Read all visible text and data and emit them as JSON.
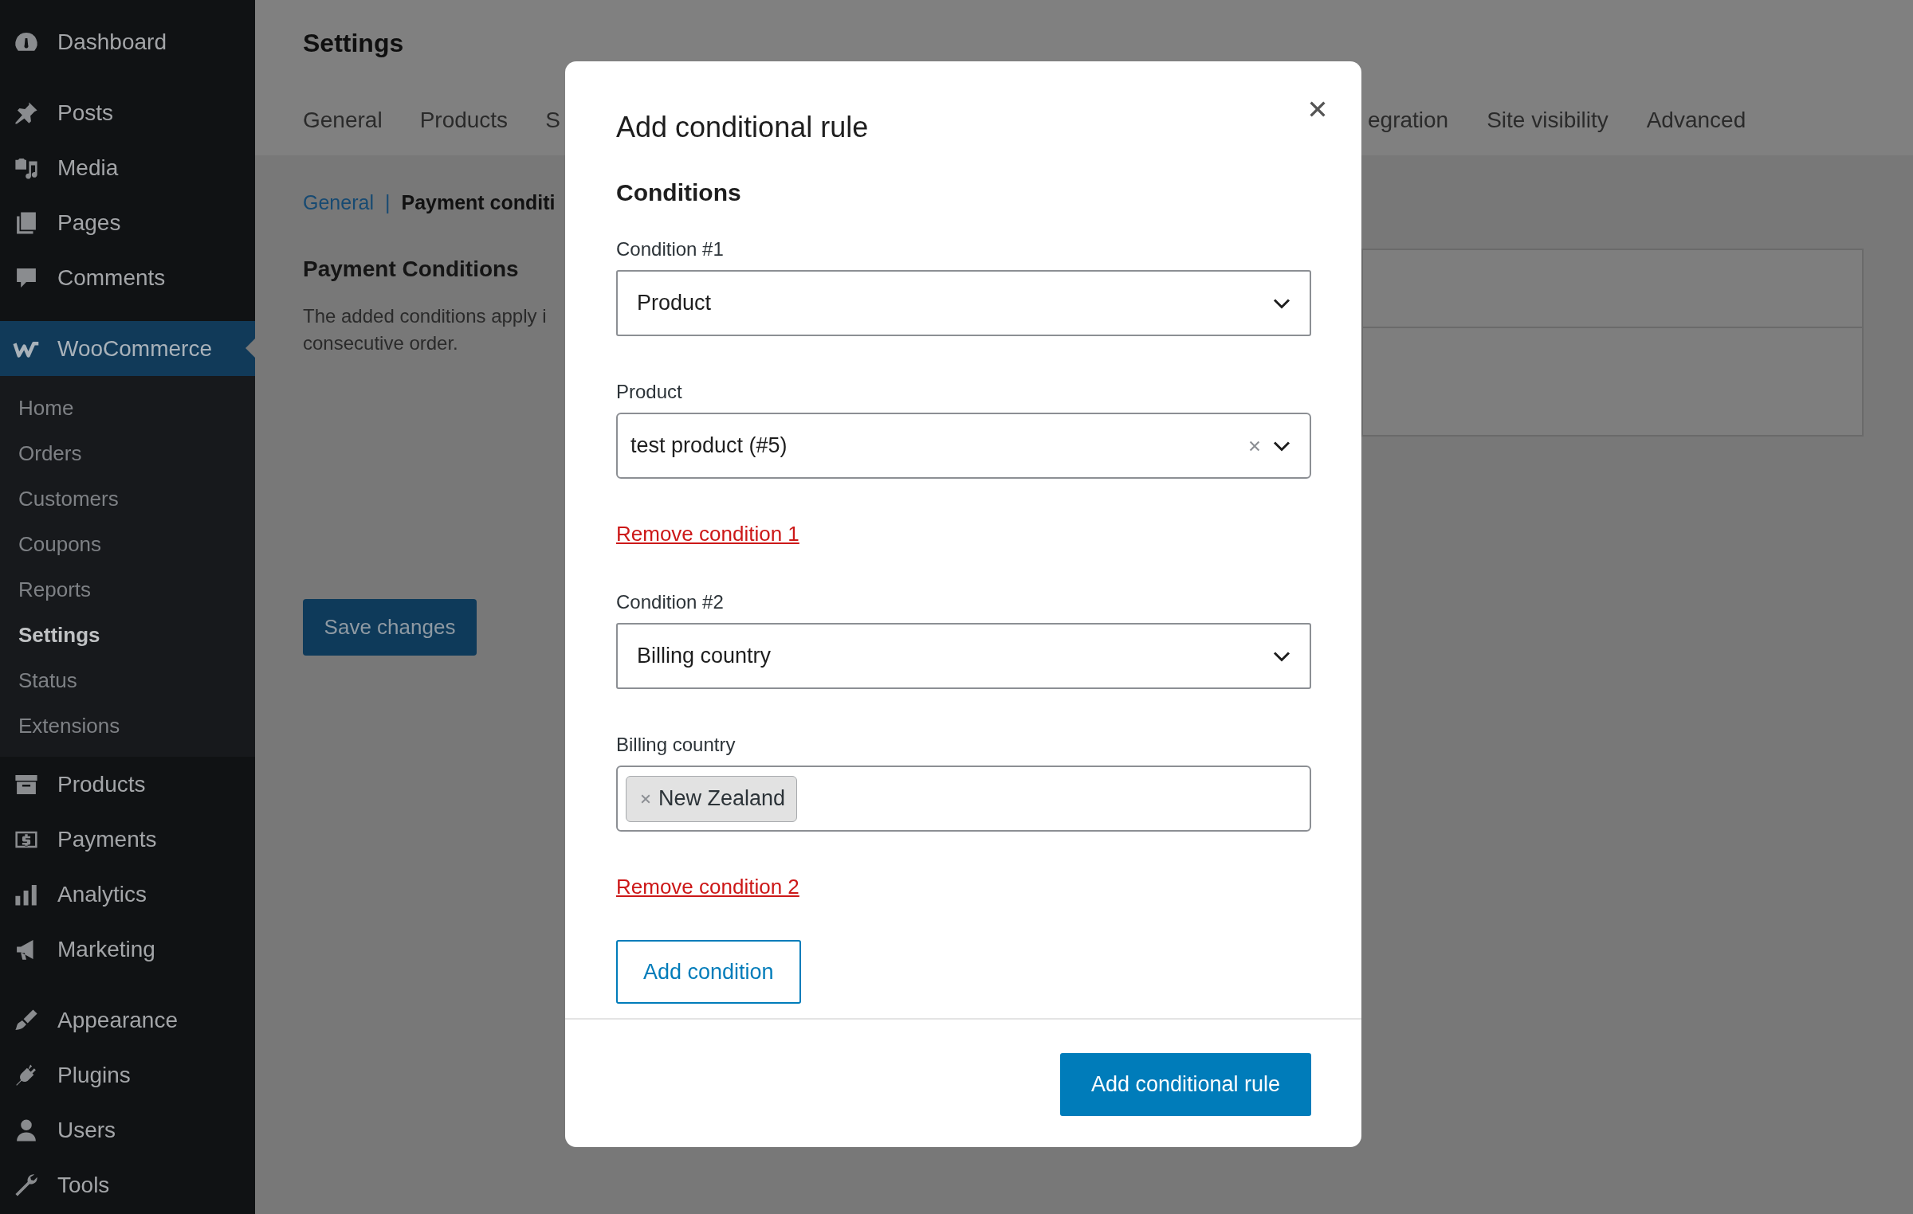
{
  "sidebar": {
    "groups": [
      {
        "items": [
          {
            "label": "Dashboard",
            "selected": false
          }
        ]
      },
      {
        "items": [
          {
            "label": "Posts",
            "selected": false
          },
          {
            "label": "Media",
            "selected": false
          },
          {
            "label": "Pages",
            "selected": false
          },
          {
            "label": "Comments",
            "selected": false
          }
        ]
      },
      {
        "items": [
          {
            "label": "WooCommerce",
            "selected": true,
            "children": [
              {
                "label": "Home",
                "selected": false
              },
              {
                "label": "Orders",
                "selected": false
              },
              {
                "label": "Customers",
                "selected": false
              },
              {
                "label": "Coupons",
                "selected": false
              },
              {
                "label": "Reports",
                "selected": false
              },
              {
                "label": "Settings",
                "selected": true
              },
              {
                "label": "Status",
                "selected": false
              },
              {
                "label": "Extensions",
                "selected": false
              }
            ]
          },
          {
            "label": "Products",
            "selected": false
          },
          {
            "label": "Payments",
            "selected": false
          },
          {
            "label": "Analytics",
            "selected": false
          },
          {
            "label": "Marketing",
            "selected": false
          }
        ]
      },
      {
        "items": [
          {
            "label": "Appearance",
            "selected": false
          },
          {
            "label": "Plugins",
            "selected": false
          },
          {
            "label": "Users",
            "selected": false
          },
          {
            "label": "Tools",
            "selected": false
          }
        ]
      }
    ]
  },
  "page": {
    "title": "Settings",
    "tabs": [
      {
        "label": "General"
      },
      {
        "label": "Products"
      },
      {
        "label": "S"
      },
      {
        "label": "egration"
      },
      {
        "label": "Site visibility"
      },
      {
        "label": "Advanced"
      }
    ],
    "breadcrumb": [
      {
        "label": "General",
        "kind": "link"
      },
      {
        "label": "|",
        "kind": "separator"
      },
      {
        "label": "Payment conditi",
        "kind": "current"
      }
    ],
    "section_title": "Payment Conditions",
    "description": "The added conditions apply i\nconsecutive order.",
    "save_button": "Save changes"
  },
  "modal": {
    "title": "Add conditional rule",
    "heading": "Conditions",
    "conditions": [
      {
        "label": "Condition #1",
        "type": "Product",
        "value_label": "Product",
        "kind": "select",
        "value": "test product (#5)",
        "clearable": true,
        "remove_link": "Remove condition 1"
      },
      {
        "label": "Condition #2",
        "type": "Billing country",
        "value_label": "Billing country",
        "kind": "tags",
        "tags": [
          "New Zealand"
        ],
        "remove_link": "Remove condition 2"
      }
    ],
    "add_condition_button": "Add condition",
    "submit_button": "Add conditional rule"
  }
}
